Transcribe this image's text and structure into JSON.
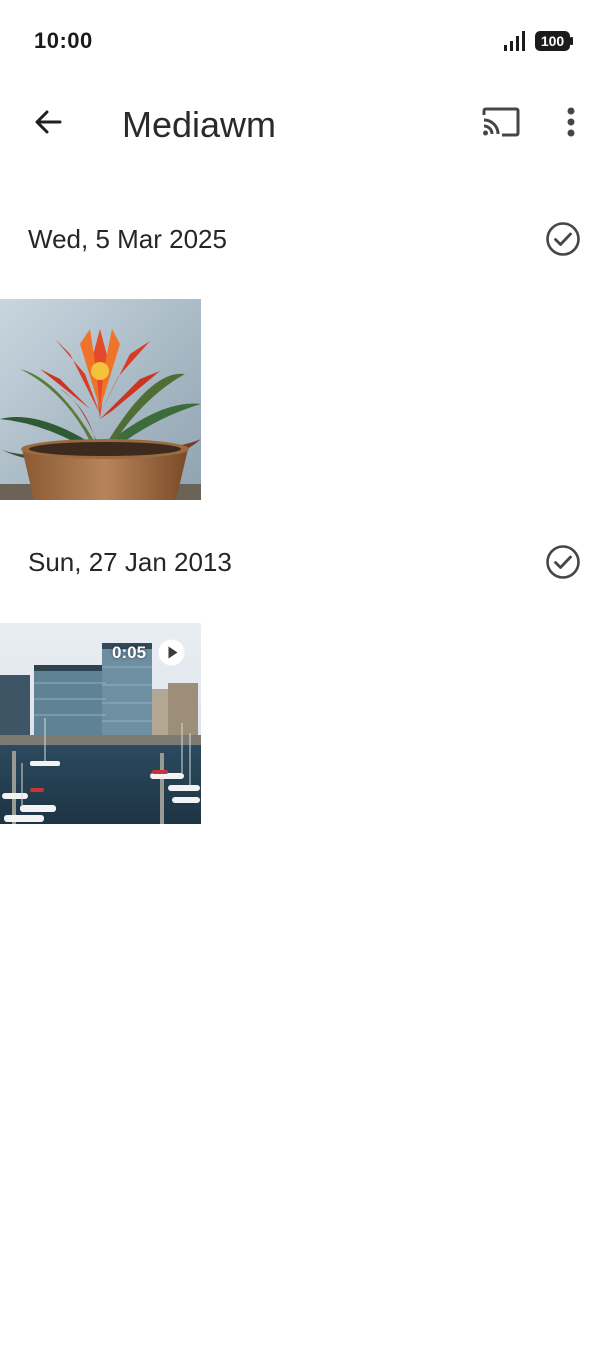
{
  "status_bar": {
    "time": "10:00",
    "battery": "100",
    "icons": [
      "signal-icon",
      "battery-icon"
    ]
  },
  "app_bar": {
    "title": "Mediawm",
    "icons": [
      "back-arrow-icon",
      "cast-icon",
      "more-vert-icon"
    ]
  },
  "sections": [
    {
      "date": "Wed, 5 Mar 2025",
      "items": [
        {
          "type": "photo",
          "subject": "potted bromeliad plant"
        }
      ]
    },
    {
      "date": "Sun, 27 Jan 2013",
      "items": [
        {
          "type": "video",
          "duration": "0:05",
          "subject": "marina with buildings"
        }
      ]
    }
  ],
  "colors": {
    "text": "#1f1f1f",
    "icon": "#444746",
    "background": "#ffffff"
  }
}
